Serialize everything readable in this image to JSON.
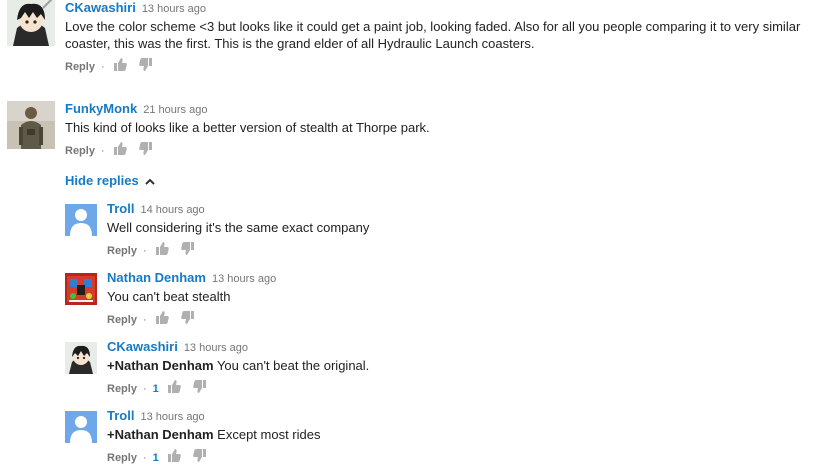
{
  "comments": [
    {
      "author": "CKawashiri",
      "time": "13 hours ago",
      "text_lines": [
        "Love the color scheme <3 but looks like it could get a paint job, looking faded. Also for all you people comparing it to very similar",
        "coaster, this was the first. This is the grand elder of all Hydraulic Launch coasters."
      ],
      "reply_label": "Reply"
    },
    {
      "author": "FunkyMonk",
      "time": "21 hours ago",
      "text": "This kind of looks like a better version of stealth at Thorpe park.",
      "reply_label": "Reply"
    }
  ],
  "hide_replies_label": "Hide replies",
  "replies": [
    {
      "author": "Troll",
      "time": "14 hours ago",
      "text": "Well considering it's the same exact company",
      "reply_label": "Reply"
    },
    {
      "author": "Nathan Denham",
      "time": "13 hours ago",
      "text": "You can't beat stealth",
      "reply_label": "Reply"
    },
    {
      "author": "CKawashiri",
      "time": "13 hours ago",
      "mention": "+Nathan Denham",
      "text": " You can't beat the original.",
      "reply_label": "Reply",
      "likes": "1"
    },
    {
      "author": "Troll",
      "time": "13 hours ago",
      "mention": "+Nathan Denham",
      "text": " Except most rides",
      "reply_label": "Reply",
      "likes": "1"
    }
  ],
  "colors": {
    "link": "#167ac6",
    "meta": "#767676",
    "text": "#222222"
  }
}
